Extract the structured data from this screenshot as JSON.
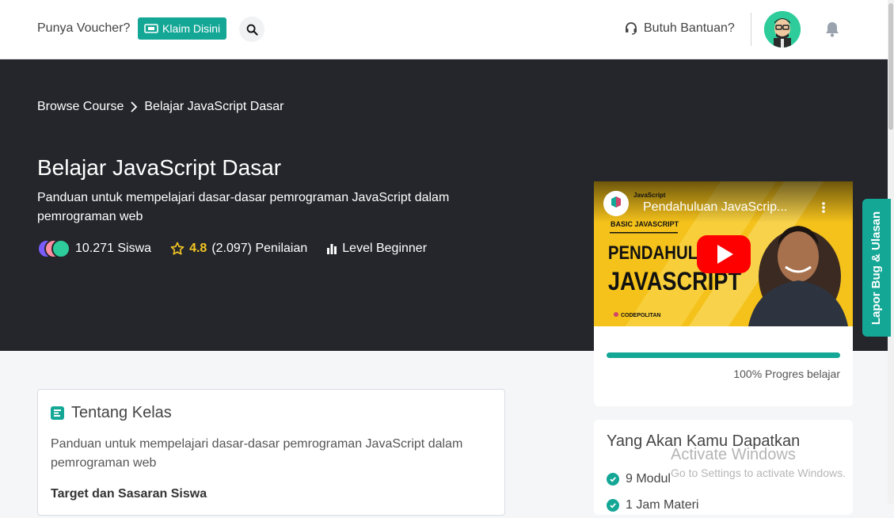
{
  "topbar": {
    "voucher_text": "Punya Voucher?",
    "claim_label": "Klaim Disini",
    "help_label": "Butuh Bantuan?"
  },
  "breadcrumb": {
    "items": [
      "Browse Course",
      "Belajar JavaScript Dasar"
    ]
  },
  "course": {
    "title": "Belajar JavaScript Dasar",
    "subtitle": "Panduan untuk mempelajari dasar-dasar pemrograman JavaScript dalam pemrograman web",
    "students": "10.271 Siswa",
    "rating": "4.8",
    "rating_count": "(2.097) Penilaian",
    "level": "Level Beginner"
  },
  "video": {
    "title": "Pendahuluan JavaScrip...",
    "channel_tag": "JavaScript",
    "badge": "BASIC JAVASCRIPT",
    "headline_line1": "PENDAHULUAN",
    "headline_line2": "JAVASCRIPT",
    "brand": "CODEPOLITAN"
  },
  "progress": {
    "value": 1.0,
    "label": "100% Progres belajar"
  },
  "side_tab": {
    "label": "Lapor Bug & Ulasan"
  },
  "about": {
    "heading": "Tentang Kelas",
    "body": "Panduan untuk mempelajari dasar-dasar pemrograman JavaScript dalam pemrograman web",
    "subheading": "Target dan Sasaran Siswa"
  },
  "gets": {
    "heading": "Yang Akan Kamu Dapatkan",
    "items": [
      "9 Modul",
      "1 Jam Materi"
    ]
  },
  "watermark": {
    "line1": "Activate Windows",
    "line2": "Go to Settings to activate Windows."
  },
  "colors": {
    "accent": "#14a796",
    "hero_bg": "#24262b",
    "star": "#f3c623",
    "youtube_red": "#ff0000"
  }
}
